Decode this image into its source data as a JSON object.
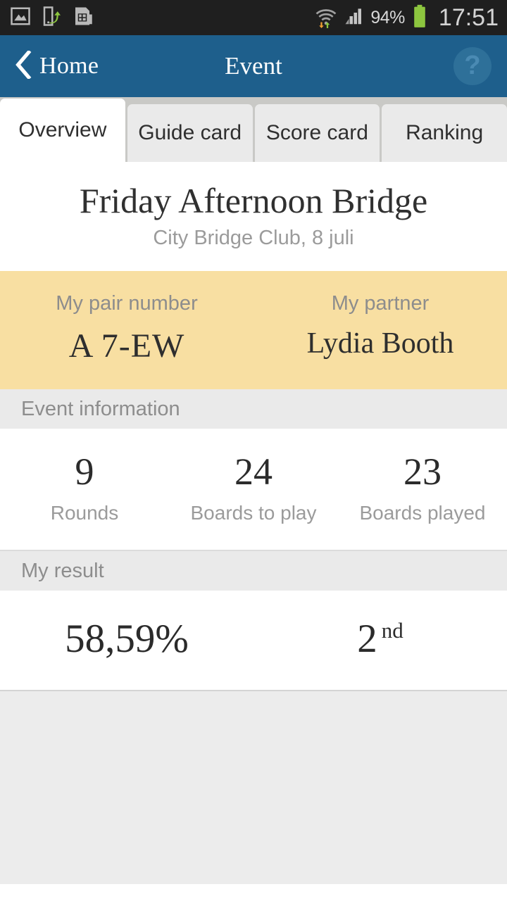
{
  "statusbar": {
    "icons": [
      "screenshot-icon",
      "smart-switch-icon",
      "sim-card-icon",
      "wifi-icon",
      "signal-bars-icon",
      "battery-icon"
    ],
    "battery_percent": "94%",
    "clock": "17:51"
  },
  "actionbar": {
    "back_label": "Home",
    "title": "Event",
    "help_glyph": "?",
    "background": "#1e5f8c"
  },
  "tabs": [
    {
      "label": "Overview",
      "active": true
    },
    {
      "label": "Guide card",
      "active": false
    },
    {
      "label": "Score card",
      "active": false
    },
    {
      "label": "Ranking",
      "active": false
    }
  ],
  "event": {
    "title": "Friday Afternoon Bridge",
    "subtitle": "City Bridge Club,  8 juli"
  },
  "pair_panel": {
    "background": "#f8dfa2",
    "pair_caption": "My pair number",
    "pair_value": "A 7-EW",
    "partner_caption": "My partner",
    "partner_value": "Lydia Booth"
  },
  "event_information": {
    "header": "Event information",
    "stats": [
      {
        "value": "9",
        "label": "Rounds"
      },
      {
        "value": "24",
        "label": "Boards to play"
      },
      {
        "value": "23",
        "label": "Boards played"
      }
    ]
  },
  "my_result": {
    "header": "My result",
    "score": "58,59%",
    "rank_number": "2",
    "rank_suffix": "nd"
  }
}
